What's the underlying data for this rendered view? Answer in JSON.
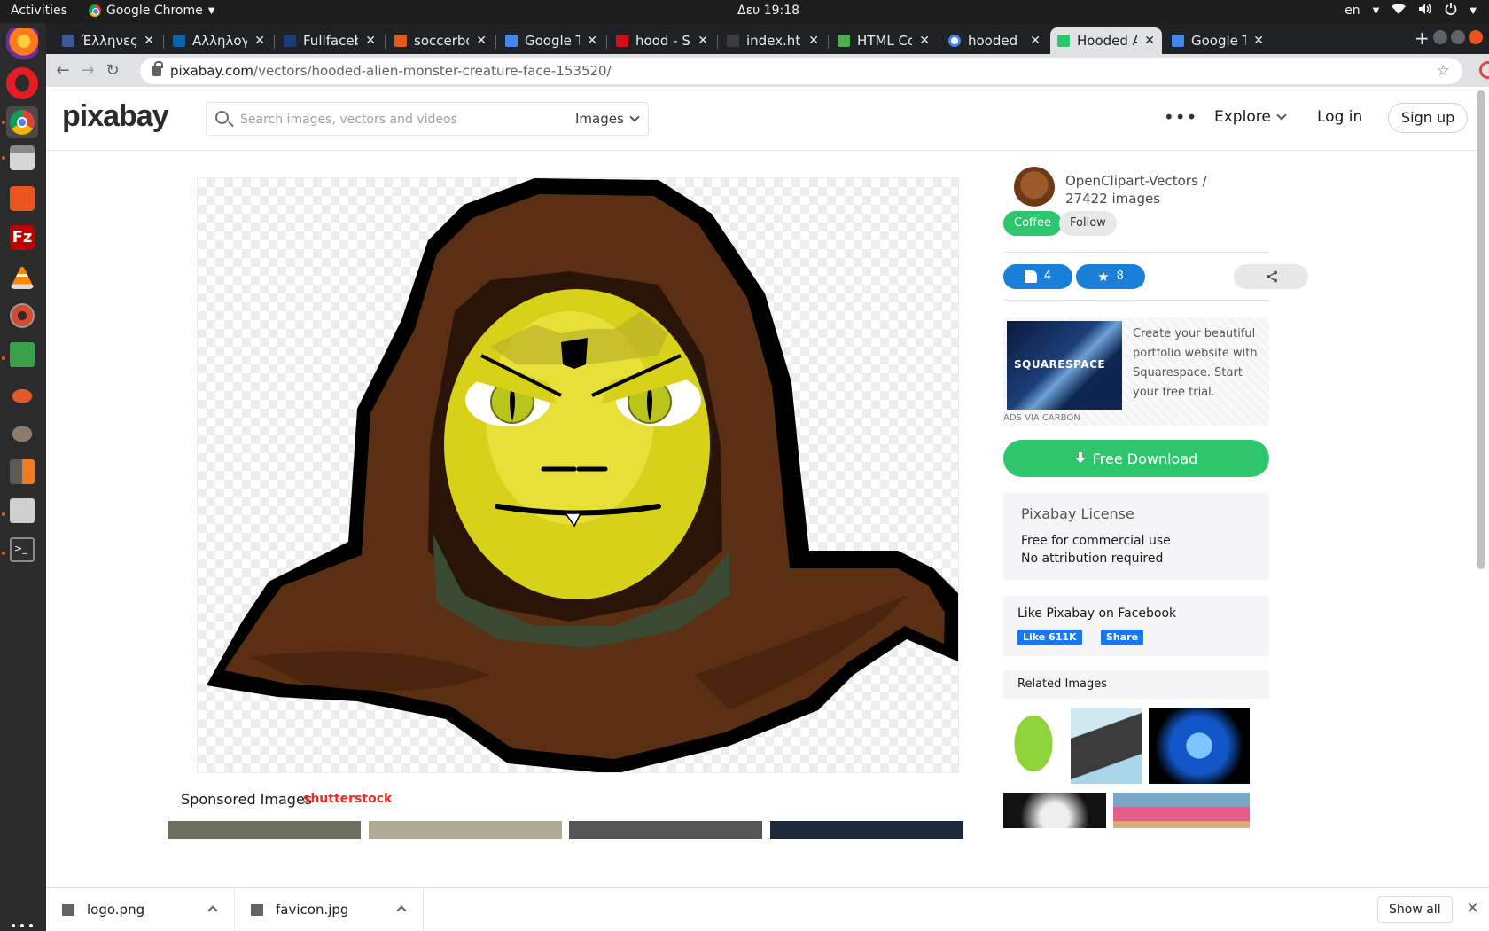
{
  "system": {
    "activities": "Activities",
    "app_name": "Google Chrome",
    "clock": "Δευ 19:18",
    "language": "en"
  },
  "tabs": [
    {
      "title": "Έλληνες Γ",
      "favicon_color": "#3b5998"
    },
    {
      "title": "Αλληλογρ",
      "favicon_color": "#0a64ad"
    },
    {
      "title": "Fullfaceb",
      "favicon_color": "#1c3b7a"
    },
    {
      "title": "soccerbot",
      "favicon_color": "#e25a1c"
    },
    {
      "title": "Google Tr",
      "favicon_color": "#4285f4"
    },
    {
      "title": "hood - Sea",
      "favicon_color": "#d10f1a"
    },
    {
      "title": "index.htm",
      "favicon_color": "#3c3c3c"
    },
    {
      "title": "HTML Col",
      "favicon_color": "#4caf50"
    },
    {
      "title": "hooded m",
      "favicon_color": "#ffffff"
    },
    {
      "title": "Hooded A",
      "favicon_color": "#2ec66d",
      "active": true
    },
    {
      "title": "Google Tr",
      "favicon_color": "#4285f4"
    }
  ],
  "url": {
    "host": "pixabay.com",
    "path": "/vectors/hooded-alien-monster-creature-face-153520/"
  },
  "site": {
    "logo": "pixabay",
    "search_placeholder": "Search images, vectors and videos",
    "search_scope": "Images",
    "explore": "Explore",
    "login": "Log in",
    "signup": "Sign up"
  },
  "author": {
    "name": "OpenClipart-Vectors",
    "separator": " / ",
    "images_count": "27422",
    "images_label": "images",
    "coffee": "Coffee",
    "follow": "Follow"
  },
  "stats": {
    "likes": "4",
    "favorites": "8"
  },
  "ad": {
    "brand": "SQUARESPACE",
    "text": "Create your beautiful portfolio website with Squarespace. Start your free trial.",
    "tag": "ADS VIA CARBON"
  },
  "download": {
    "label": "Free Download"
  },
  "license": {
    "title": "Pixabay License",
    "line1": "Free for commercial use",
    "line2": "No attribution required"
  },
  "facebook": {
    "title": "Like Pixabay on Facebook",
    "like": "Like 611K",
    "share": "Share"
  },
  "related": {
    "heading": "Related Images"
  },
  "sponsored": {
    "label": "Sponsored Images",
    "brand": "shutterstock"
  },
  "downloads_shelf": {
    "items": [
      "logo.png",
      "favicon.jpg"
    ],
    "show_all": "Show all"
  },
  "colors": {
    "accent_green": "#2ec66d",
    "accent_blue": "#1a7fd9",
    "hood_brown": "#5b2f14",
    "face_yellow": "#d8d11a"
  }
}
